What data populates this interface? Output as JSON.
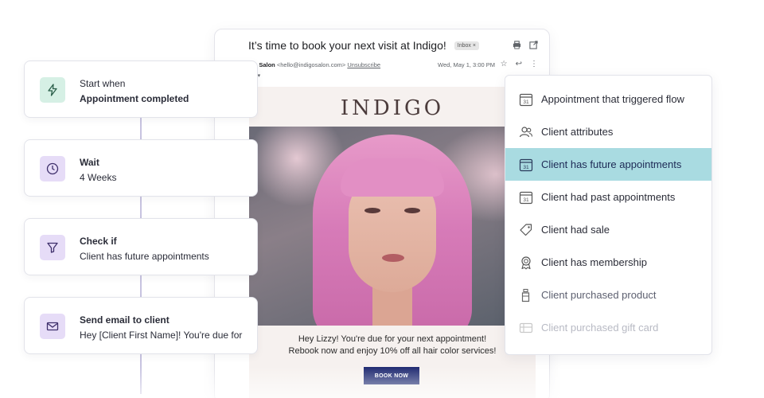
{
  "email": {
    "subject": "It’s time to book your next visit at Indigo!",
    "inbox_chip": "Inbox ×",
    "sender_name": "igo Salon",
    "sender_email": "<hello@indigosalon.com>",
    "unsubscribe": "Unsubscribe",
    "date": "Wed, May 1, 3:00 PM",
    "to_line": "me ▾",
    "brand": "INDIGO",
    "promo_line1": "Hey Lizzy! You're due for your next appointment!",
    "promo_line2": "Rebook now and enjoy 10% off all hair color services!",
    "book_button": "BOOK NOW"
  },
  "workflow": {
    "cards": [
      {
        "title": "Start when",
        "detail": "Appointment completed",
        "icon": "lightning-icon",
        "color": "#d6f0e5"
      },
      {
        "title": "Wait",
        "detail": "4 Weeks",
        "icon": "clock-icon",
        "color": "#e6dcf7"
      },
      {
        "title": "Check if",
        "detail": "Client has future appointments",
        "icon": "funnel-icon",
        "color": "#e6dcf7"
      },
      {
        "title": "Send email to client",
        "detail": "Hey [Client First Name]! You're due for",
        "icon": "envelope-icon",
        "color": "#e6dcf7"
      }
    ]
  },
  "conditions": {
    "selected": "Client has future appointments",
    "highlight_color": "#a9dbe1",
    "items": [
      {
        "label": "Appointment that triggered flow",
        "icon": "calendar-icon"
      },
      {
        "label": "Client attributes",
        "icon": "people-icon"
      },
      {
        "label": "Client has future appointments",
        "icon": "calendar-icon"
      },
      {
        "label": "Client had past appointments",
        "icon": "calendar-icon"
      },
      {
        "label": "Client had sale",
        "icon": "tag-icon"
      },
      {
        "label": "Client has membership",
        "icon": "badge-icon"
      },
      {
        "label": "Client purchased product",
        "icon": "bottle-icon"
      },
      {
        "label": "Client purchased gift card",
        "icon": "gift-card-icon"
      }
    ]
  },
  "calendar_day": "31"
}
